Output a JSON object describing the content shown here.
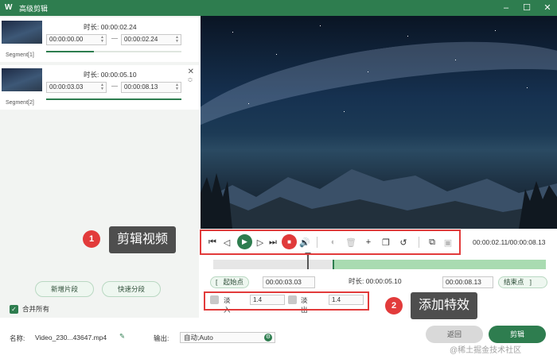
{
  "window": {
    "title": "高级剪辑",
    "logo": "W",
    "minimize": "–",
    "maximize": "☐",
    "close": "✕"
  },
  "segments": [
    {
      "label": "Segment[1]",
      "duration_label": "时长: 00:00:02.24",
      "start": "00:00:00.00",
      "end": "00:00:02.24"
    },
    {
      "label": "Segment[2]",
      "duration_label": "时长: 00:00:05.10",
      "start": "00:00:03.03",
      "end": "00:00:08.13"
    }
  ],
  "left_buttons": {
    "add_segment": "新增片段",
    "quick_split": "快速分段"
  },
  "merge_all": {
    "label": "合并所有",
    "checked": true
  },
  "player": {
    "timecode": "00:00:02.11/00:00:08.13"
  },
  "range": {
    "start_btn": "起始点",
    "start_value": "00:00:03.03",
    "duration": "时长: 00:00:05.10",
    "end_value": "00:00:08.13",
    "end_btn": "结束点"
  },
  "effects": {
    "fade_in_label": "淡入",
    "fade_in_value": "1.4",
    "fade_out_label": "淡出",
    "fade_out_value": "1.4"
  },
  "annotations": [
    {
      "number": "1",
      "text": "剪辑视频"
    },
    {
      "number": "2",
      "text": "添加特效"
    }
  ],
  "bottom": {
    "name_label": "名称:",
    "name_value": "Video_230...43647.mp4",
    "output_label": "输出:",
    "output_value": "自动;Auto",
    "back_button": "返回",
    "cut_button": "剪辑"
  },
  "watermark": "@稀土掘金技术社区",
  "colors": {
    "accent": "#2e7d4f",
    "highlight": "#e23b3b",
    "stop": "#e03a3a"
  }
}
